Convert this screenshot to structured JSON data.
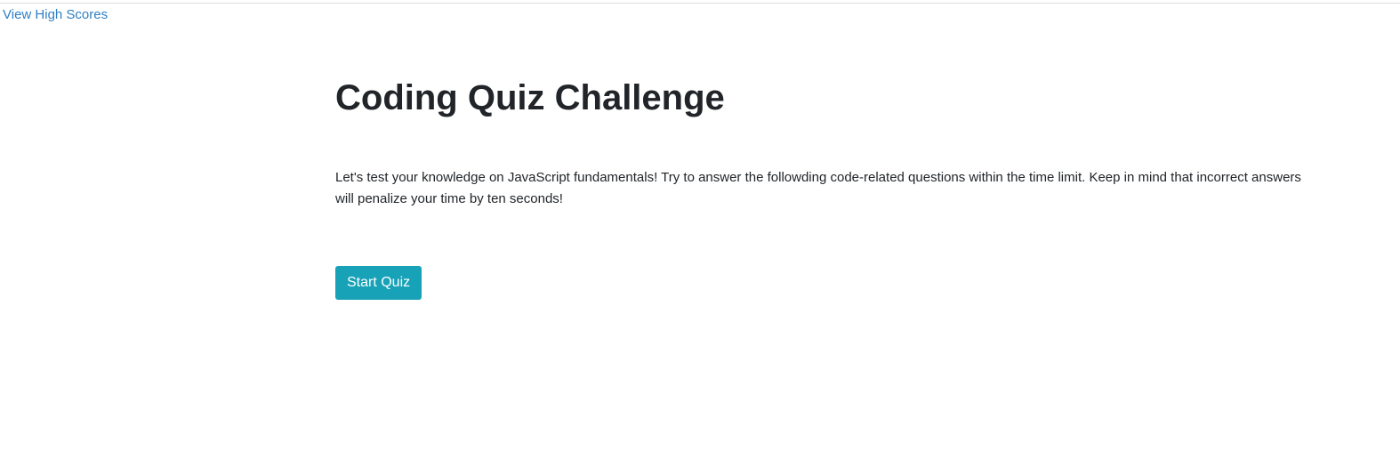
{
  "nav": {
    "high_scores_label": "View High Scores"
  },
  "main": {
    "title": "Coding Quiz Challenge",
    "intro": "Let's test your knowledge on JavaScript fundamentals! Try to answer the followding code-related questions within the time limit. Keep in mind that incorrect answers will penalize your time by ten seconds!",
    "start_button_label": "Start Quiz"
  },
  "colors": {
    "link": "#2f7fc4",
    "button_background": "#17a2b8",
    "button_text": "#ffffff",
    "text": "#212529"
  }
}
